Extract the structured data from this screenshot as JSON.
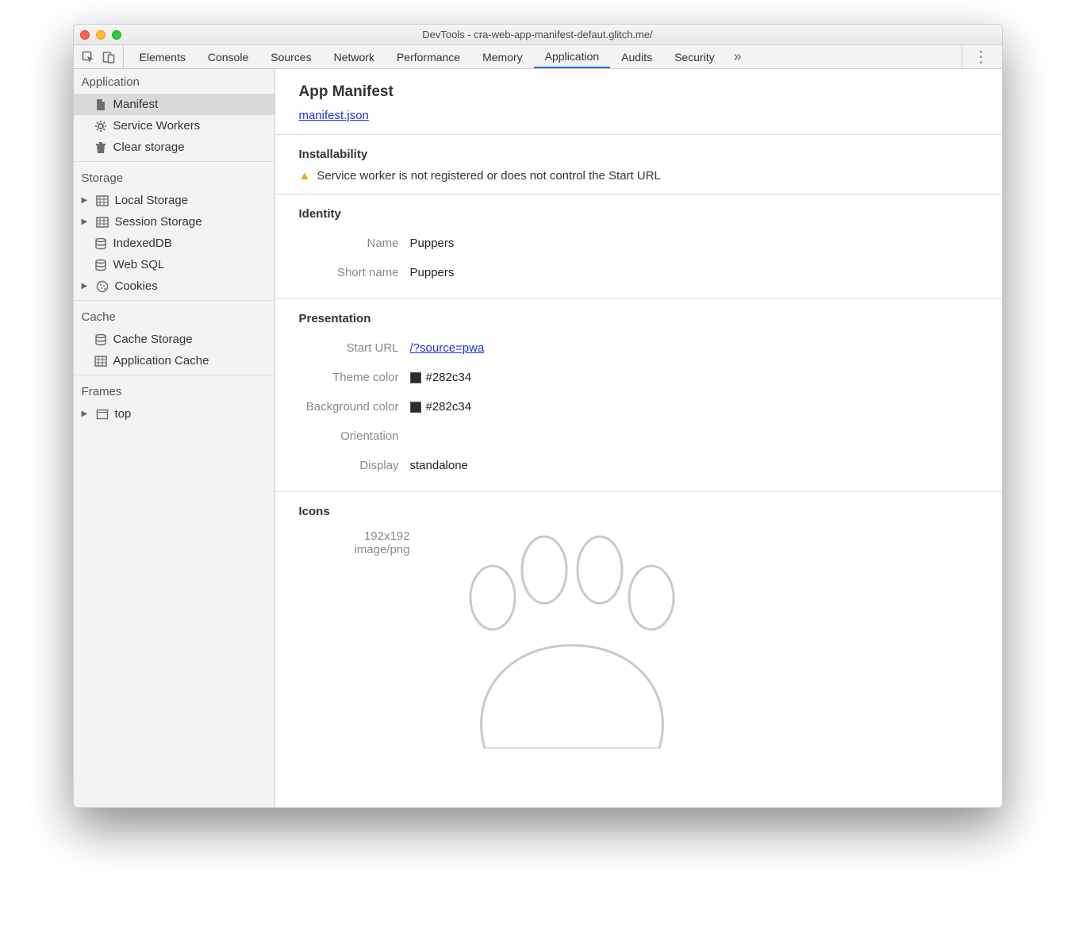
{
  "window": {
    "title": "DevTools - cra-web-app-manifest-defaut.glitch.me/"
  },
  "tabs": {
    "items": [
      "Elements",
      "Console",
      "Sources",
      "Network",
      "Performance",
      "Memory",
      "Application",
      "Audits",
      "Security"
    ],
    "active": "Application",
    "more": "»"
  },
  "sidebar": {
    "sections": [
      {
        "title": "Application",
        "items": [
          {
            "label": "Manifest",
            "icon": "file-icon",
            "selected": true
          },
          {
            "label": "Service Workers",
            "icon": "gear-icon"
          },
          {
            "label": "Clear storage",
            "icon": "trash-icon"
          }
        ]
      },
      {
        "title": "Storage",
        "items": [
          {
            "label": "Local Storage",
            "icon": "grid-icon",
            "expandable": true
          },
          {
            "label": "Session Storage",
            "icon": "grid-icon",
            "expandable": true
          },
          {
            "label": "IndexedDB",
            "icon": "db-icon"
          },
          {
            "label": "Web SQL",
            "icon": "db-icon"
          },
          {
            "label": "Cookies",
            "icon": "cookie-icon",
            "expandable": true
          }
        ]
      },
      {
        "title": "Cache",
        "items": [
          {
            "label": "Cache Storage",
            "icon": "db-icon"
          },
          {
            "label": "Application Cache",
            "icon": "grid-icon"
          }
        ]
      },
      {
        "title": "Frames",
        "items": [
          {
            "label": "top",
            "icon": "frame-icon",
            "expandable": true
          }
        ]
      }
    ]
  },
  "main": {
    "title": "App Manifest",
    "manifest_link": "manifest.json",
    "installability": {
      "heading": "Installability",
      "warning": "Service worker is not registered or does not control the Start URL"
    },
    "identity": {
      "heading": "Identity",
      "rows": {
        "name_label": "Name",
        "name_value": "Puppers",
        "short_name_label": "Short name",
        "short_name_value": "Puppers"
      }
    },
    "presentation": {
      "heading": "Presentation",
      "rows": {
        "start_url_label": "Start URL",
        "start_url_value": "/?source=pwa",
        "theme_color_label": "Theme color",
        "theme_color_value": "#282c34",
        "bg_color_label": "Background color",
        "bg_color_value": "#282c34",
        "orientation_label": "Orientation",
        "orientation_value": "",
        "display_label": "Display",
        "display_value": "standalone"
      }
    },
    "icons": {
      "heading": "Icons",
      "size": "192x192",
      "mime": "image/png"
    }
  }
}
